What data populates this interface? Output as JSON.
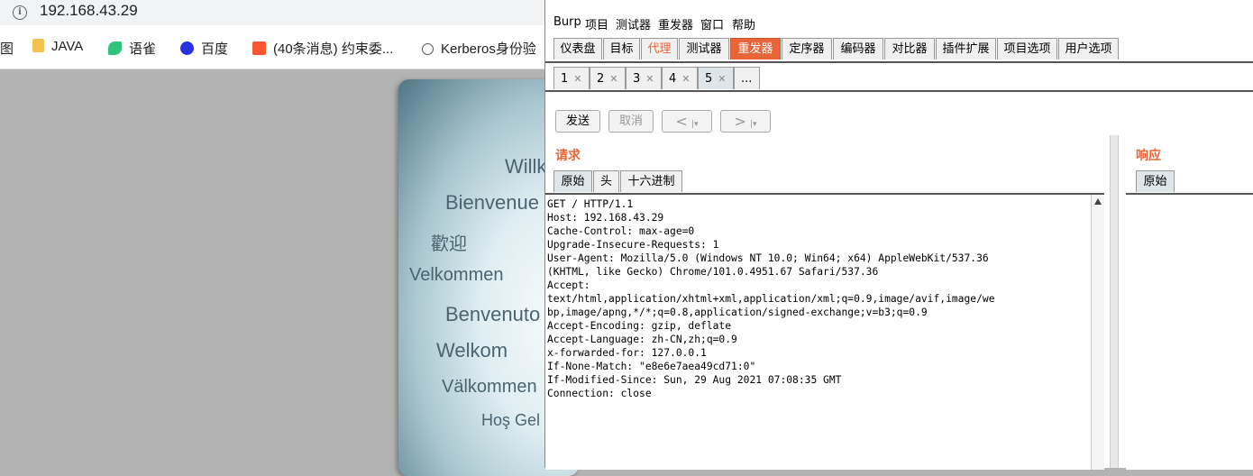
{
  "browser": {
    "url": "192.168.43.29",
    "bookmarks": [
      {
        "label": "图",
        "icon": "bookmark-icon"
      },
      {
        "label": "JAVA",
        "icon": "folder-icon",
        "color": "#f2c14e"
      },
      {
        "label": "语雀",
        "icon": "yuque-icon",
        "color": "#31c27c"
      },
      {
        "label": "百度",
        "icon": "baidu-icon",
        "color": "#2932e1"
      },
      {
        "label": "(40条消息) 约束委...",
        "icon": "csdn-icon",
        "color": "#fc5531"
      },
      {
        "label": "Kerberos身份验",
        "icon": "kerberos-icon"
      }
    ]
  },
  "webpage": {
    "greetings": [
      "Willk",
      "Bienvenue",
      "歡迎",
      "Velkommen",
      "Benvenuto",
      "Welkom",
      "Välkommen",
      "Hoş Gel"
    ]
  },
  "burp": {
    "menu": [
      "Burp",
      "项目",
      "测试器",
      "重发器",
      "窗口",
      "帮助"
    ],
    "main_tabs": [
      "仪表盘",
      "目标",
      "代理",
      "测试器",
      "重发器",
      "定序器",
      "编码器",
      "对比器",
      "插件扩展",
      "项目选项",
      "用户选项"
    ],
    "repeater_tabs": [
      "1",
      "2",
      "3",
      "4",
      "5",
      "..."
    ],
    "buttons": {
      "send": "发送",
      "cancel": "取消",
      "back": "<",
      "forward": ">"
    },
    "request": {
      "title": "请求",
      "tabs": [
        "原始",
        "头",
        "十六进制"
      ],
      "lines": [
        "GET / HTTP/1.1",
        "Host: 192.168.43.29",
        "Cache-Control: max-age=0",
        "Upgrade-Insecure-Requests: 1",
        "User-Agent: Mozilla/5.0 (Windows NT 10.0; Win64; x64) AppleWebKit/537.36",
        "(KHTML, like Gecko) Chrome/101.0.4951.67 Safari/537.36",
        "Accept:",
        "text/html,application/xhtml+xml,application/xml;q=0.9,image/avif,image/we",
        "bp,image/apng,*/*;q=0.8,application/signed-exchange;v=b3;q=0.9",
        "Accept-Encoding: gzip, deflate",
        "Accept-Language: zh-CN,zh;q=0.9",
        "x-forwarded-for: 127.0.0.1",
        "If-None-Match: \"e8e6e7aea49cd71:0\"",
        "If-Modified-Since: Sun, 29 Aug 2021 07:08:35 GMT",
        "Connection: close"
      ]
    },
    "response": {
      "title": "响应",
      "tabs": [
        "原始"
      ]
    },
    "colors": {
      "accent": "#e8653a"
    }
  }
}
